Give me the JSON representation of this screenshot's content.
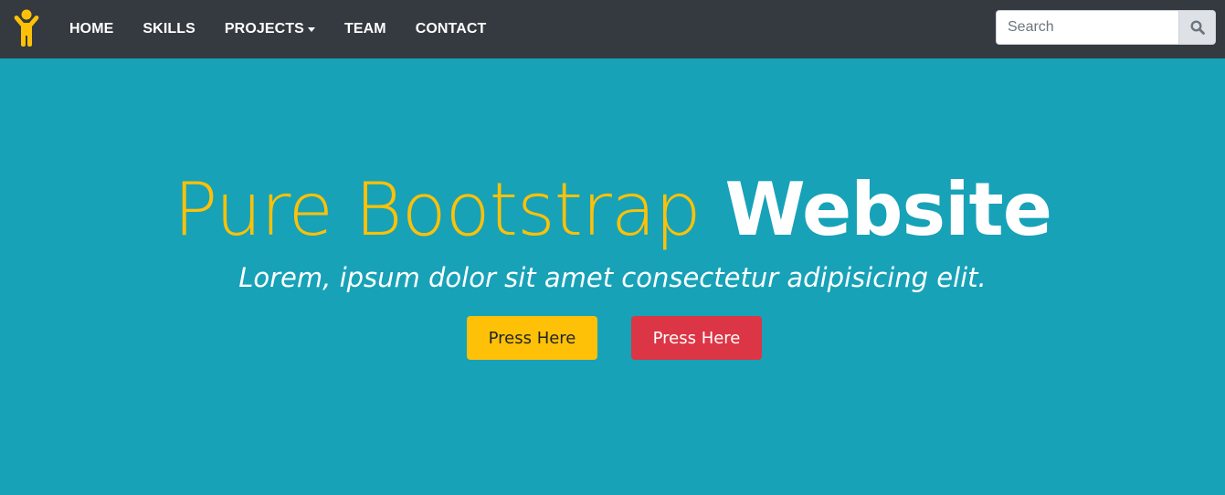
{
  "nav": {
    "brand_icon": "person-raising-arms-icon",
    "links": [
      {
        "label": "HOME"
      },
      {
        "label": "SKILLS"
      },
      {
        "label": "PROJECTS"
      },
      {
        "label": "TEAM"
      },
      {
        "label": "CONTACT"
      }
    ],
    "search": {
      "placeholder": "Search",
      "value": ""
    }
  },
  "hero": {
    "title_light": "Pure Bootstrap",
    "title_bold": "Website",
    "subtitle": "Lorem, ipsum dolor sit amet consectetur adipisicing elit.",
    "primary_button": "Press Here",
    "secondary_button": "Press Here"
  },
  "colors": {
    "navbar": "#343a40",
    "hero_bg": "#17a2b8",
    "warning": "#ffc107",
    "danger": "#dc3545"
  }
}
